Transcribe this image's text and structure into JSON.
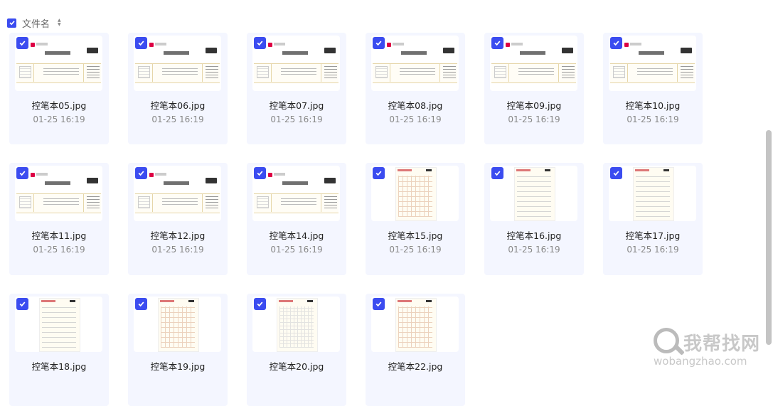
{
  "header": {
    "label": "文件名",
    "sort_up": "▲",
    "sort_down": "▼"
  },
  "files": [
    {
      "name": "控笔本05.jpg",
      "date": "01-25 16:19",
      "thumb": "land"
    },
    {
      "name": "控笔本06.jpg",
      "date": "01-25 16:19",
      "thumb": "land"
    },
    {
      "name": "控笔本07.jpg",
      "date": "01-25 16:19",
      "thumb": "land"
    },
    {
      "name": "控笔本08.jpg",
      "date": "01-25 16:19",
      "thumb": "land"
    },
    {
      "name": "控笔本09.jpg",
      "date": "01-25 16:19",
      "thumb": "land"
    },
    {
      "name": "控笔本10.jpg",
      "date": "01-25 16:19",
      "thumb": "land"
    },
    {
      "name": "控笔本11.jpg",
      "date": "01-25 16:19",
      "thumb": "land"
    },
    {
      "name": "控笔本12.jpg",
      "date": "01-25 16:19",
      "thumb": "land"
    },
    {
      "name": "控笔本14.jpg",
      "date": "01-25 16:19",
      "thumb": "land"
    },
    {
      "name": "控笔本15.jpg",
      "date": "01-25 16:19",
      "thumb": "port"
    },
    {
      "name": "控笔本16.jpg",
      "date": "01-25 16:19",
      "thumb": "port plain"
    },
    {
      "name": "控笔本17.jpg",
      "date": "01-25 16:19",
      "thumb": "port plain"
    },
    {
      "name": "控笔本18.jpg",
      "date": "",
      "thumb": "port plain"
    },
    {
      "name": "控笔本19.jpg",
      "date": "",
      "thumb": "port"
    },
    {
      "name": "控笔本20.jpg",
      "date": "",
      "thumb": "port grey"
    },
    {
      "name": "控笔本22.jpg",
      "date": "",
      "thumb": "port"
    }
  ],
  "watermark": {
    "cn": "我帮找网",
    "en": "wobangzhao.com"
  },
  "colors": {
    "accent": "#3b4cf0",
    "card_bg": "#f4f6ff"
  }
}
